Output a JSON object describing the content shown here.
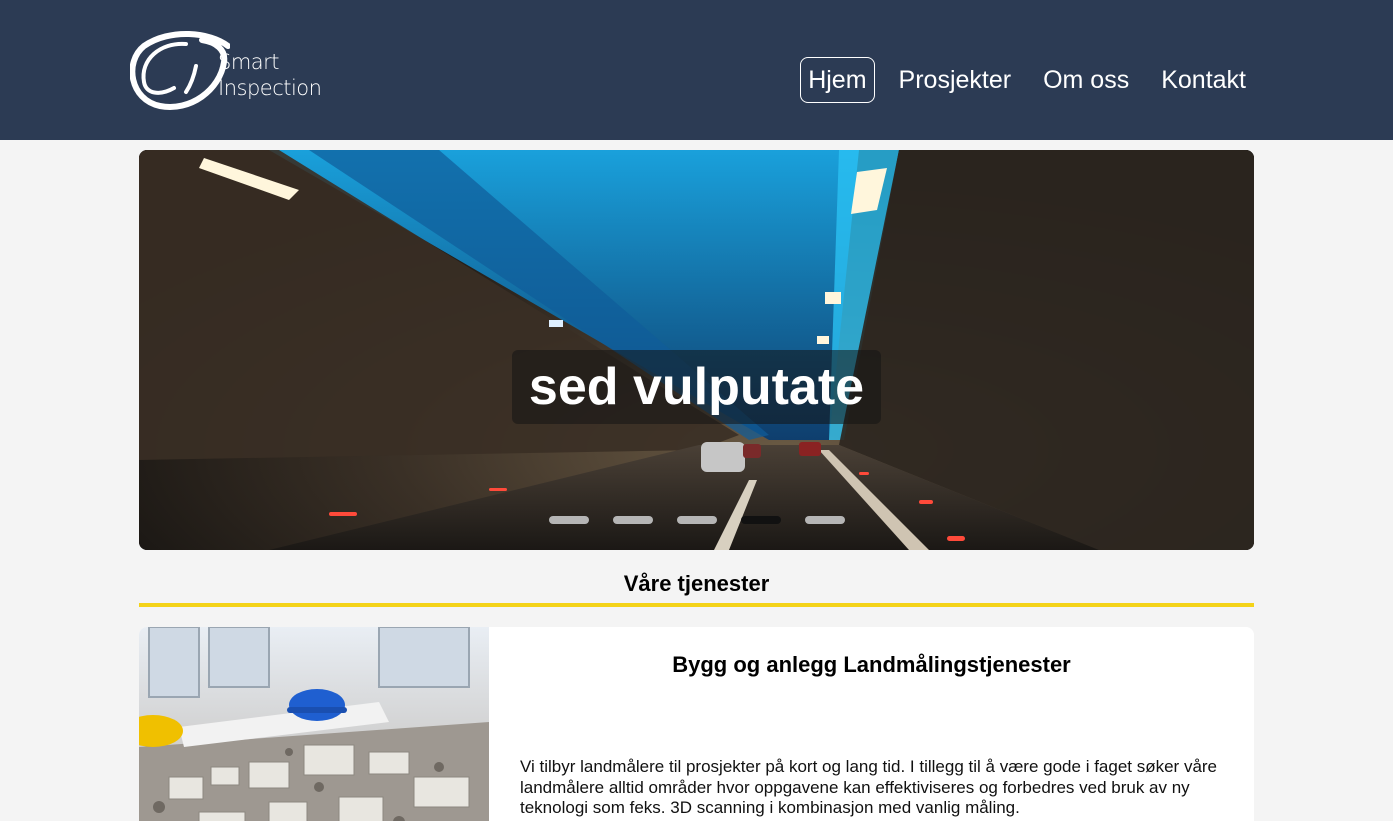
{
  "header": {
    "logo": {
      "line1": "Smart",
      "line2": "Inspection"
    },
    "nav": [
      {
        "label": "Hjem",
        "active": true
      },
      {
        "label": "Prosjekter",
        "active": false
      },
      {
        "label": "Om oss",
        "active": false
      },
      {
        "label": "Kontakt",
        "active": false
      }
    ]
  },
  "hero": {
    "caption": "sed vulputate",
    "slide_count": 5,
    "active_slide": 4
  },
  "services": {
    "title": "Våre tjenester",
    "cards": [
      {
        "title": "Bygg og anlegg Landmålingstjenester",
        "text": "Vi tilbyr landmålere til prosjekter på kort og lang tid. I tillegg til å være gode i faget søker våre landmålere alltid områder hvor oppgavene kan effektiviseres og forbedres ved bruk av ny teknologi som feks. 3D scanning i kombinasjon med vanlig måling."
      }
    ]
  },
  "colors": {
    "header_bg": "#2c3b54",
    "accent_rule": "#f4d318",
    "page_bg": "#f4f4f4"
  }
}
